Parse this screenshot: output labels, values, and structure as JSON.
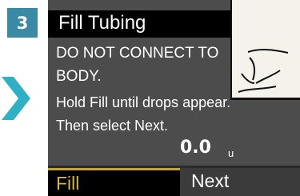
{
  "step": {
    "number": "3"
  },
  "screen": {
    "title": "Fill Tubing",
    "lines": [
      "DO NOT CONNECT TO",
      "BODY.",
      "Hold Fill until drops appear.",
      "Then select Next."
    ],
    "value": "0.0",
    "unit": "u"
  },
  "softkeys": {
    "fill": "Fill",
    "next": "Next"
  },
  "colors": {
    "step_badge": "#3a8aa6",
    "arrow": "#2fb0c4",
    "screen_bg": "#4c4c4c",
    "title_bar": "#000000",
    "fill_key_text": "#d7b63c"
  }
}
